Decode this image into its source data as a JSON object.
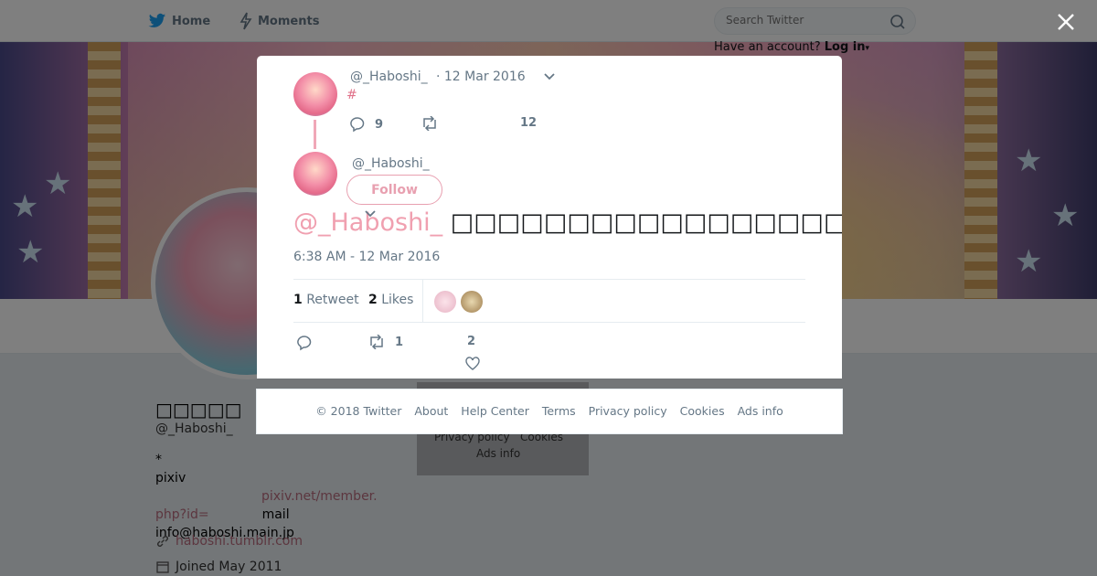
{
  "nav": {
    "home": "Home",
    "moments": "Moments"
  },
  "search": {
    "placeholder": "Search Twitter"
  },
  "login": {
    "prompt": "Have an account?",
    "link": "Log in"
  },
  "profile": {
    "name": "□□□□□",
    "handle": "@_Haboshi_",
    "bio_line1": "*",
    "bio_pixiv_prefix": "pixiv",
    "bio_pixiv_link": "pixiv.net/member.",
    "bio_pixiv_link2": "php?id=",
    "bio_mail_suffix": "mail",
    "bio_email": "info@haboshi.main.jp",
    "website": "haboshi.tumblr.com",
    "joined": "Joined May 2011"
  },
  "under_footer": {
    "privacy": "Privacy policy",
    "cookies": "Cookies",
    "ads": "Ads info"
  },
  "parent_tweet": {
    "handle": "@_Haboshi_",
    "date": "· 12 Mar 2016",
    "hashtag": "#",
    "replies": "9",
    "likes": "12"
  },
  "main_tweet": {
    "handle": "@_Haboshi_",
    "follow_label": "Follow",
    "mention": "@_Haboshi_",
    "text": "□□□□□□□□□□□□□□□□□□□□□( .. )□□□□□□□□□□□□□□□□□□□□□",
    "timestamp": "6:38 AM - 12 Mar 2016",
    "retweet_count": "1",
    "retweet_label": "Retweet",
    "like_count": "2",
    "like_label": "Likes",
    "action_retweets": "1",
    "action_likes": "2"
  },
  "footer": {
    "copyright": "© 2018 Twitter",
    "about": "About",
    "help": "Help Center",
    "terms": "Terms",
    "privacy": "Privacy policy",
    "cookies": "Cookies",
    "ads": "Ads info"
  },
  "colors": {
    "accent": "#e8a0b0",
    "muted": "#657786",
    "twitter_blue": "#1da1f2"
  }
}
